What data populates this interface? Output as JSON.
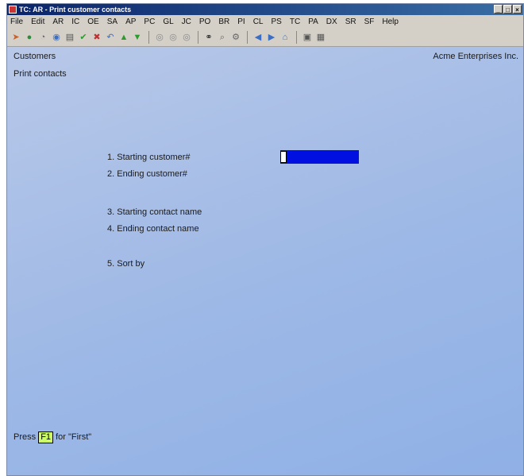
{
  "window": {
    "title": "TC: AR - Print customer contacts"
  },
  "menu": [
    "File",
    "Edit",
    "AR",
    "IC",
    "OE",
    "SA",
    "AP",
    "PC",
    "GL",
    "JC",
    "PO",
    "BR",
    "PI",
    "CL",
    "PS",
    "TC",
    "PA",
    "DX",
    "SR",
    "SF",
    "Help"
  ],
  "toolbar": {
    "icons": [
      "arrow-icon",
      "circle-icon",
      "magnify-icon",
      "globe-icon",
      "printer-icon",
      "checkmark-icon",
      "cross-icon",
      "undo-icon",
      "up-arrow-icon",
      "down-arrow-icon",
      "circle-1-icon",
      "circle-2-icon",
      "circle-3-icon",
      "binoculars-icon",
      "search-icon",
      "gear-icon",
      "left-arrow-icon",
      "right-arrow-icon",
      "home-icon",
      "save-icon",
      "grid-icon"
    ]
  },
  "header": {
    "module": "Customers",
    "screen": "Print contacts",
    "company": "Acme Enterprises Inc."
  },
  "fields": [
    {
      "label": "1. Starting customer#"
    },
    {
      "label": "2. Ending customer#"
    },
    {
      "label": "3. Starting contact name"
    },
    {
      "label": "4. Ending contact name"
    },
    {
      "label": "5. Sort by"
    }
  ],
  "status": {
    "prefix": "Press",
    "key": "F1",
    "suffix": "for \"First\""
  },
  "colors": {
    "input_highlight": "#0010e0",
    "fkey_badge": "#ccff66"
  }
}
